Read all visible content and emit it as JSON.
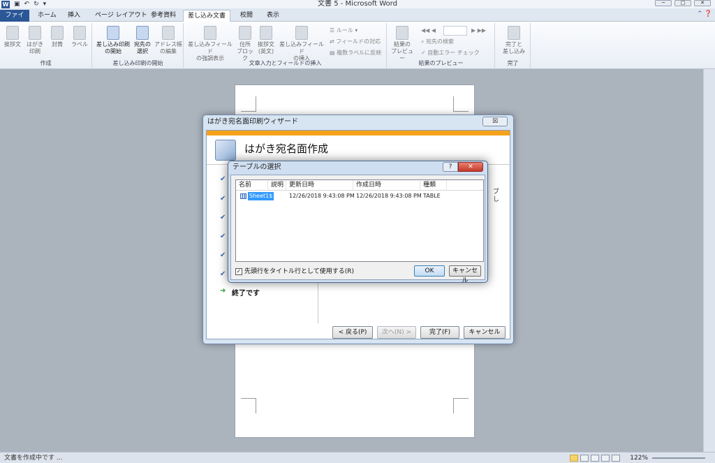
{
  "window": {
    "title": "文書 5 - Microsoft Word",
    "logo_letter": "W"
  },
  "tabs": {
    "file": "ファイル",
    "home": "ホーム",
    "insert": "挿入",
    "page_layout": "ページ レイアウト",
    "references": "参考資料",
    "mailings": "差し込み文書",
    "review": "校閲",
    "view": "表示"
  },
  "ribbon": {
    "create": {
      "label": "作成",
      "greeting": "挨拶文",
      "hagaki": "はがき\n印刷",
      "envelope": "封筒",
      "label_btn": "ラベル"
    },
    "start": {
      "label": "差し込み印刷の開始",
      "start_merge": "差し込み印刷\nの開始",
      "select_recipients": "宛先の\n選択",
      "edit_list": "アドレス帳\nの編集"
    },
    "fields": {
      "label": "文章入力とフィールドの挿入",
      "highlight": "差し込みフィールド\nの強調表示",
      "address_block": "住所\nブロック",
      "greeting_en": "挨拶文\n(英文)",
      "insert_field": "差し込みフィールド\nの挿入",
      "rules": "ルール",
      "match_fields": "フィールドの対応",
      "update_labels": "複数ラベルに反映"
    },
    "preview": {
      "label": "結果のプレビュー",
      "preview_results": "結果の\nプレビュー",
      "find_recipient": "宛先の検索",
      "auto_check": "自動エラー チェック"
    },
    "finish": {
      "label": "完了",
      "finish_merge": "完了と\n差し込み"
    }
  },
  "wizard": {
    "title": "はがき宛名面印刷ウィザード",
    "close": "☒",
    "heading": "はがき宛名面作成",
    "final_step": "終了です",
    "partial_text_1": "ブ",
    "partial_text_2": "し",
    "back": "< 戻る(P)",
    "next": "次へ(N) >",
    "finish": "完了(F)",
    "cancel": "キャンセル"
  },
  "table_dialog": {
    "title": "テーブルの選択",
    "help": "?",
    "close": "✕",
    "columns": [
      "名前",
      "説明",
      "更新日時",
      "作成日時",
      "種類"
    ],
    "rows": [
      {
        "name": "Sheet1$",
        "description": "",
        "modified": "12/26/2018 9:43:08 PM",
        "created": "12/26/2018 9:43:08 PM",
        "type": "TABLE"
      }
    ],
    "checkbox_label": "先頭行をタイトル行として使用する(R)",
    "checkbox_checked": true,
    "ok": "OK",
    "cancel": "キャンセル"
  },
  "statusbar": {
    "status": "文書を作成中です ...",
    "zoom": "122%"
  }
}
